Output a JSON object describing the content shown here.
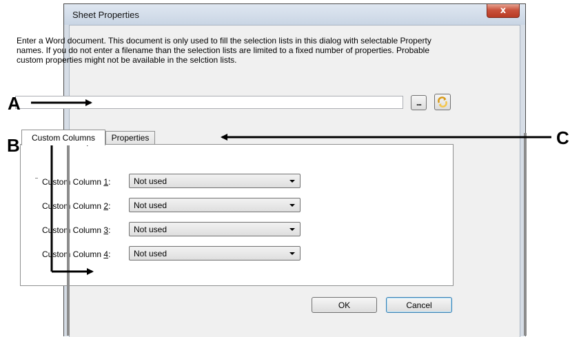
{
  "window": {
    "title": "Sheet Properties",
    "close_glyph": "x"
  },
  "description": "Enter a Word document. This document is only used to fill the selection lists in this dialog with selectable Property names. If you do not enter a filename than the selection lists are limited to a fixed number of properties. Probable custom properties might not be available in the selction lists.",
  "file_input": {
    "value": "",
    "placeholder": ""
  },
  "browse_button": {
    "label": "...",
    "icon": "ellipsis-icon"
  },
  "refresh_button": {
    "icon": "refresh-arrows-icon",
    "colors": {
      "outer": "#d89a18",
      "inner": "#f4c64c"
    }
  },
  "tabs": [
    {
      "label": "Custom Columns",
      "active": true
    },
    {
      "label": "Properties",
      "active": false
    }
  ],
  "custom_columns": [
    {
      "label_prefix": "Custom Column ",
      "number": "1",
      "label_suffix": ":",
      "value": "Not used"
    },
    {
      "label_prefix": "Custom Column ",
      "number": "2",
      "label_suffix": ":",
      "value": "Not used"
    },
    {
      "label_prefix": "Custom Column ",
      "number": "3",
      "label_suffix": ":",
      "value": "Not used"
    },
    {
      "label_prefix": "Custom Column ",
      "number": "4",
      "label_suffix": ":",
      "value": "Not used"
    }
  ],
  "buttons": {
    "ok": "OK",
    "cancel": "Cancel"
  },
  "callouts": {
    "a": "A",
    "b": "B",
    "c": "C"
  },
  "colors": {
    "close_button": "#c9523c",
    "frame": "#d6dde6",
    "default_button_border": "#3c7fb1"
  }
}
